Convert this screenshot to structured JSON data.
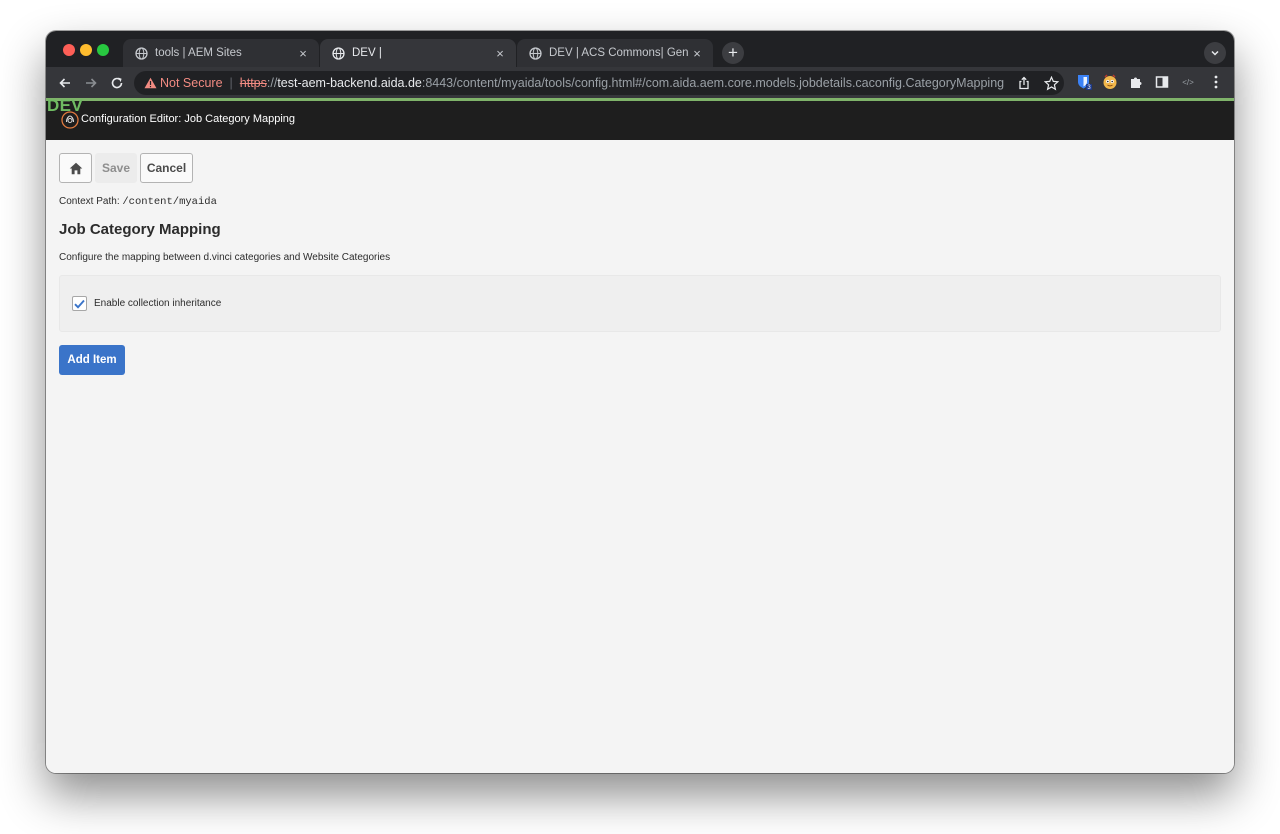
{
  "browser": {
    "tabs": [
      {
        "title": "tools | AEM Sites",
        "active": false
      },
      {
        "title": "DEV |",
        "active": true
      },
      {
        "title": "DEV | ACS Commons| Generic",
        "active": false
      }
    ],
    "new_tab_label": "+",
    "close_glyph": "×",
    "address": {
      "security_text": "Not Secure",
      "separator": "|",
      "scheme": "https",
      "scheme_suffix": "://",
      "host": "test-aem-backend.aida.de",
      "path": ":8443/content/myaida/tools/config.html#/com.aida.aem.core.models.jobdetails.caconfig.CategoryMapping"
    },
    "extension_badge": "3",
    "devtools_ext_label": "</>"
  },
  "aem": {
    "env_label": "DEV",
    "header_title": "Configuration Editor: Job Category Mapping"
  },
  "editor": {
    "save_label": "Save",
    "cancel_label": "Cancel",
    "context_path_label": "Context Path:",
    "context_path_value": "/content/myaida",
    "title": "Job Category Mapping",
    "description": "Configure the mapping between d.vinci categories and Website Categories",
    "inheritance_label": "Enable collection inheritance",
    "inheritance_checked": true,
    "add_item_label": "Add Item"
  },
  "colors": {
    "accent_blue": "#3a74c9",
    "env_green": "#6fbb62",
    "warning_red": "#f28b82"
  }
}
